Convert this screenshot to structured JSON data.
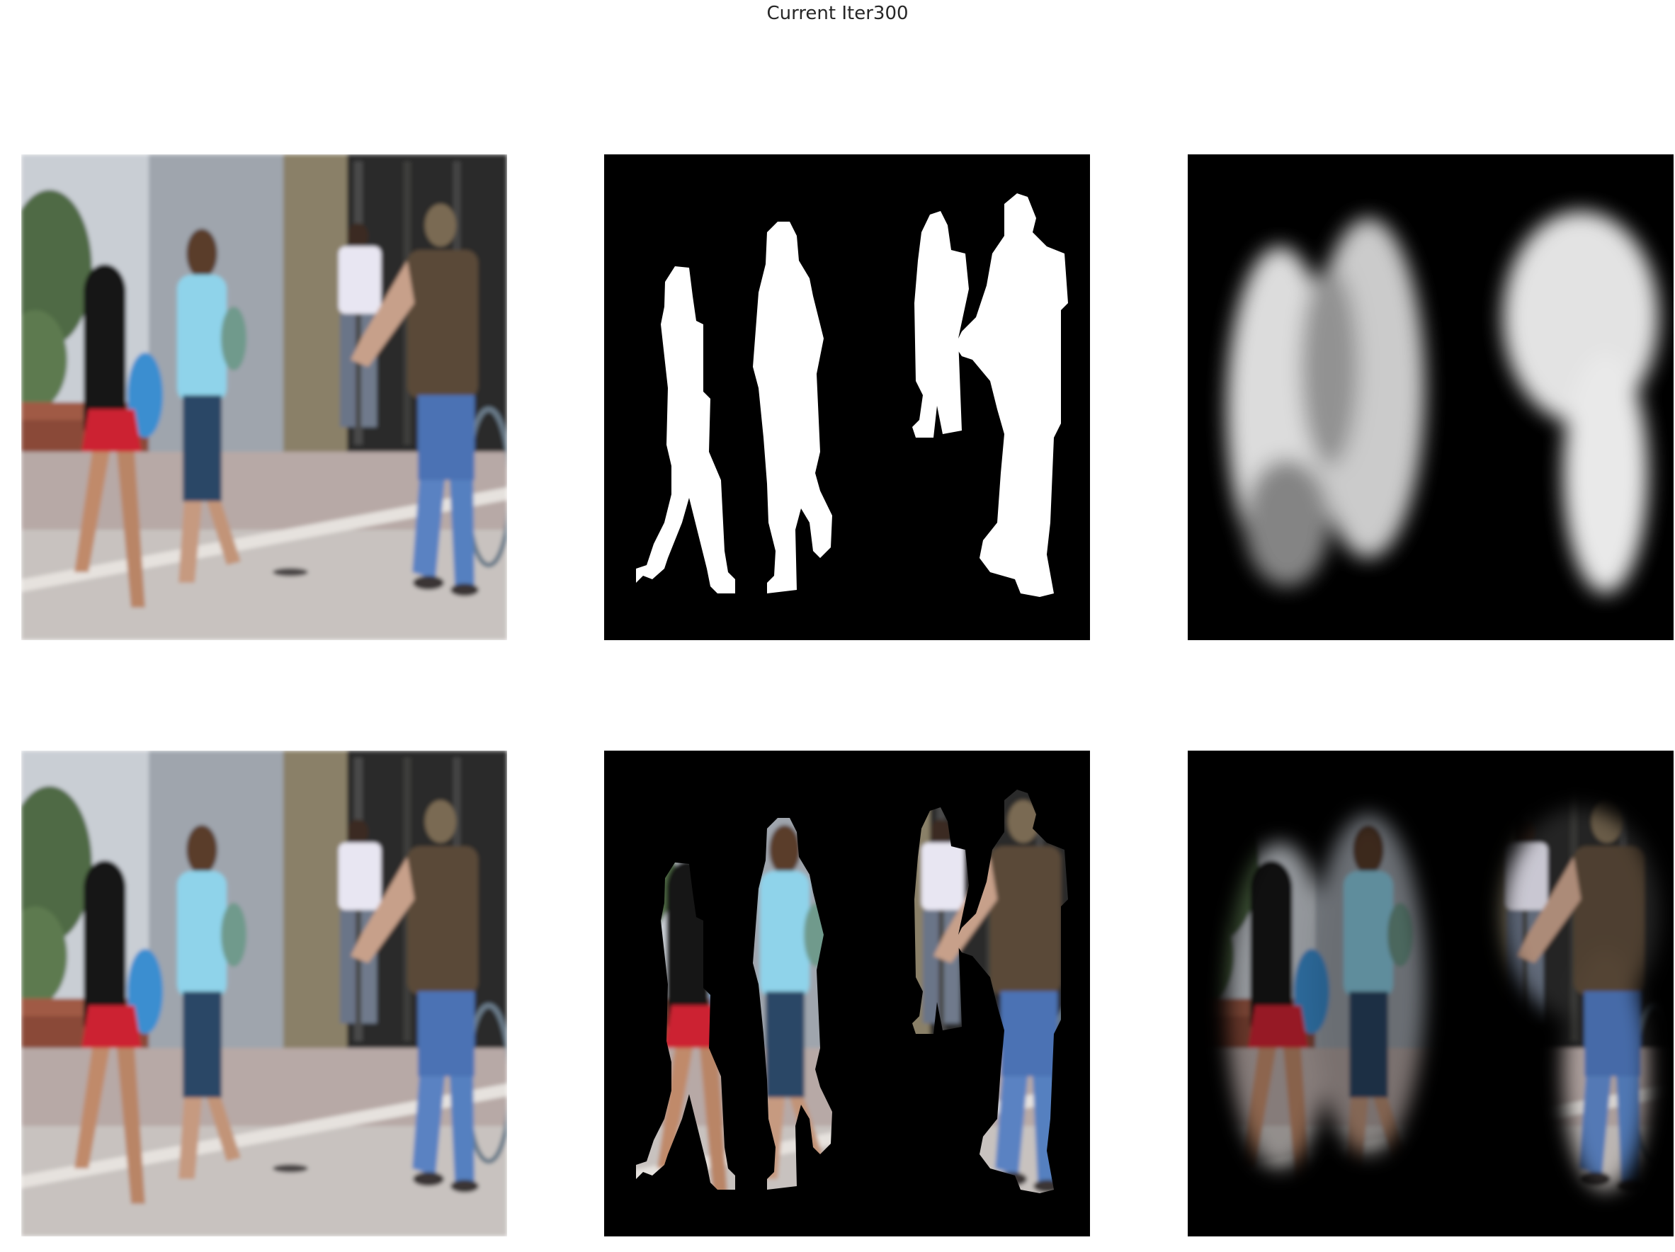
{
  "figure": {
    "title": "Current Iter300"
  },
  "panels": [
    {
      "id": "input-image-top",
      "kind": "photo"
    },
    {
      "id": "ground-truth-mask",
      "kind": "binary-mask"
    },
    {
      "id": "predicted-mask",
      "kind": "soft-mask"
    },
    {
      "id": "input-image-bottom",
      "kind": "photo"
    },
    {
      "id": "ground-truth-masked-image",
      "kind": "masked-photo"
    },
    {
      "id": "predicted-masked-image",
      "kind": "soft-masked-photo"
    }
  ]
}
